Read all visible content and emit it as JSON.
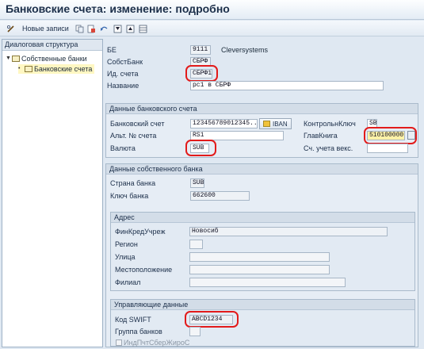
{
  "window": {
    "title": "Банковские счета: изменение: подробно"
  },
  "toolbar": {
    "new_entries_label": "Новые записи"
  },
  "tree": {
    "header": "Диалоговая структура",
    "root": "Собственные банки",
    "child": "Банковские счета"
  },
  "form": {
    "be_label": "БЕ",
    "be_value": "9111",
    "be_name": "Cleversystems",
    "own_bank_label": "СобстБанк",
    "own_bank_value": "СБРФ",
    "account_id_label": "Ид. счета",
    "account_id_value": "СБРФ1",
    "name_label": "Название",
    "name_value": "рс1 в СБРФ"
  },
  "bank_account": {
    "title": "Данные банковского счета",
    "account_label": "Банковский счет",
    "account_value": "123456789012345...",
    "iban_label": "IBAN",
    "control_key_label": "КонтрольнКлюч",
    "control_key_value": "SB",
    "alt_no_label": "Альт. № счета",
    "alt_no_value": "RS1",
    "gl_label": "ГлавКнига",
    "gl_value": "510100000",
    "currency_label": "Валюта",
    "currency_value": "SUB",
    "bill_acc_label": "Сч. учета векс.",
    "bill_acc_value": ""
  },
  "bank_data": {
    "title": "Данные собственного банка",
    "country_label": "Страна банка",
    "country_value": "SUB",
    "bank_key_label": "Ключ банка",
    "bank_key_value": "662600",
    "address": {
      "title": "Адрес",
      "inst_label": "ФинКредУчреж",
      "inst_value": "Новосиб",
      "region_label": "Регион",
      "region_value": "",
      "street_label": "Улица",
      "street_value": "",
      "location_label": "Местоположение",
      "location_value": "",
      "branch_label": "Филиал",
      "branch_value": ""
    },
    "control": {
      "title": "Управляющие данные",
      "swift_label": "Код SWIFT",
      "swift_value": "ABCD1234",
      "group_label": "Группа банков",
      "group_value": "",
      "postal_label": "ИндПчтСберЖироС"
    }
  }
}
